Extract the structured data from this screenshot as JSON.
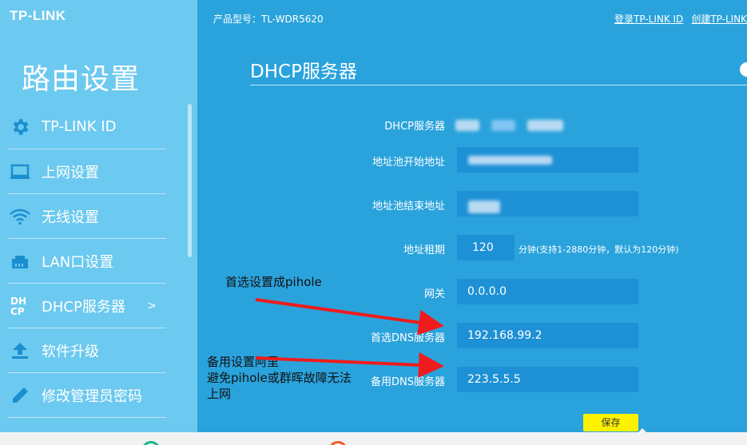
{
  "brand": "TP-LINK",
  "sidebar": {
    "title": "路由设置",
    "items": [
      {
        "label": "TP-LINK ID",
        "icon": "gear-icon"
      },
      {
        "label": "上网设置",
        "icon": "monitor-icon"
      },
      {
        "label": "无线设置",
        "icon": "wifi-icon"
      },
      {
        "label": "LAN口设置",
        "icon": "lan-port-icon"
      },
      {
        "label": "DHCP服务器",
        "icon": "dhcp-icon",
        "arrow": ">"
      },
      {
        "label": "软件升级",
        "icon": "upload-icon"
      },
      {
        "label": "修改管理员密码",
        "icon": "pencil-icon"
      }
    ],
    "dhcp_icon_text": "DH\nCP"
  },
  "header": {
    "model": "产品型号：TL-WDR5620",
    "login_link": "登录TP-LINK ID",
    "create_link": "创建TP-LINK"
  },
  "section": {
    "title": "DHCP服务器"
  },
  "form": {
    "dhcp_label": "DHCP服务器",
    "pool_start_label": "地址池开始地址",
    "pool_end_label": "地址池结束地址",
    "lease_label": "地址租期",
    "lease_value": "120",
    "lease_hint": "分钟(支持1-2880分钟，默认为120分钟)",
    "gateway_label": "网关",
    "gateway_value": "0.0.0.0",
    "dns1_label": "首选DNS服务器",
    "dns1_value": "192.168.99.2",
    "dns2_label": "备用DNS服务器",
    "dns2_value": "223.5.5.5",
    "save_label": "保存"
  },
  "annotations": {
    "note1": "首选设置成pihole",
    "note2_line1": "备用设置阿里",
    "note2_line2": "避免pihole或群晖故障无法",
    "note2_line3": "上网"
  },
  "colors": {
    "sidebar": "#6cc9ef",
    "main": "#2aa3dc",
    "input": "#1e91d6",
    "save": "#fff200",
    "arrow": "#ee1c1c"
  }
}
